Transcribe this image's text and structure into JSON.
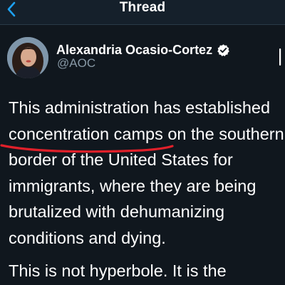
{
  "header": {
    "title": "Thread",
    "back_icon": "chevron-left-icon"
  },
  "tweet": {
    "author_name": "Alexandria Ocasio-Cortez",
    "handle": "@AOC",
    "verified_icon": "verified-badge-icon",
    "text_lines": [
      "This administration has established",
      "concentration camps on the southern",
      "border of the United States for",
      "immigrants, where they are being",
      "brutalized with dehumanizing",
      "conditions and dying."
    ],
    "text_next": "This is not hyperbole. It is the"
  },
  "colors": {
    "background": "#10171e",
    "header_bg": "#15202b",
    "accent": "#1da1f2",
    "muted_text": "#8899a6",
    "annotation_red": "#e0202a"
  }
}
